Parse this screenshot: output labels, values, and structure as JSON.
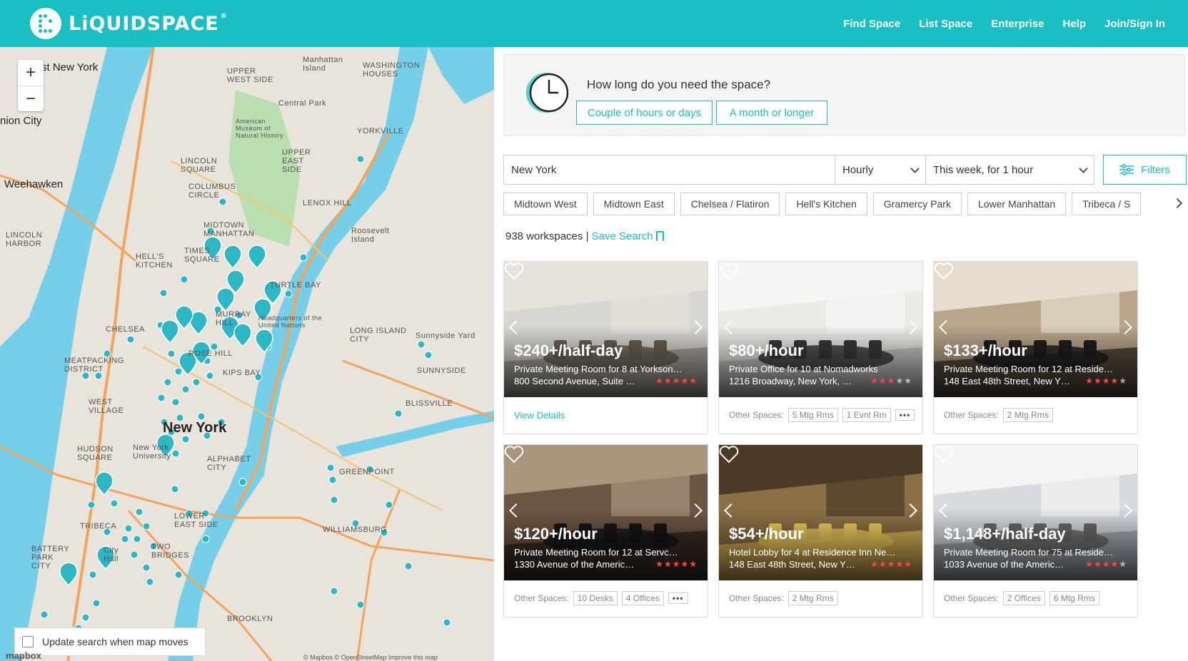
{
  "header": {
    "brand": "LiQUIDSPACE",
    "nav": [
      "Find Space",
      "List Space",
      "Enterprise",
      "Help",
      "Join/Sign In"
    ]
  },
  "map": {
    "labels": [
      "st New York",
      "nion City",
      "Weehawken",
      "UPPER WEST SIDE",
      "Manhattan Island",
      "WASHINGTON HOUSES",
      "Central Park",
      "American Museum of Natural History",
      "YORKVILLE",
      "UPPER EAST SIDE",
      "LINCOLN SQUARE",
      "COLUMBUS CIRCLE",
      "LENOX HILL",
      "LINCOLN HARBOR",
      "HELL'S KITCHEN",
      "MIDTOWN MANHATTAN",
      "TIMES SQUARE",
      "TURTLE BAY",
      "Roosevelt Island",
      "MURRAY HILL",
      "Headquarters of the United Nations",
      "CHELSEA",
      "LONG ISLAND CITY",
      "Sunnyside Yard",
      "ROSE HILL",
      "MEATPACKING DISTRICT",
      "KIPS BAY",
      "SUNNYSIDE",
      "WEST VILLAGE",
      "New York",
      "BLISSVILLE",
      "HUDSON SQUARE",
      "New York University",
      "ALPHABET CITY",
      "GREENPOINT",
      "TRIBECA",
      "LOWER EAST SIDE",
      "WILLIAMSBURG",
      "BATTERY PARK CITY",
      "TWO BRIDGES",
      "City Hall",
      "BROOKLYN"
    ],
    "update_label": "Update search when map moves",
    "credit": "mapbox",
    "attribution": "© Mapbox © OpenStreetMap Improve this map",
    "zoom_in": "+",
    "zoom_out": "−"
  },
  "duration": {
    "question": "How long do you need the space?",
    "option1": "Couple of hours or days",
    "option2": "A month or longer"
  },
  "search": {
    "location": "New York",
    "rate": "Hourly",
    "when": "This week, for 1 hour",
    "filters": "Filters"
  },
  "neighborhoods": [
    "Midtown West",
    "Midtown East",
    "Chelsea / Flatiron",
    "Hell's Kitchen",
    "Gramercy Park",
    "Lower Manhattan",
    "Tribeca / S"
  ],
  "results": {
    "count": "938 workspaces",
    "separator": "|",
    "save": "Save Search"
  },
  "cards": [
    {
      "price": "$240+/half-day",
      "name": "Private Meeting Room for 8 at Yorkson…",
      "address": "800 Second Avenue, Suite …",
      "stars": 5,
      "foot_type": "view",
      "view": "View Details",
      "tags": []
    },
    {
      "price": "$80+/hour",
      "name": "Private Office for 10 at Nomadworks",
      "address": "1216 Broadway, New York, …",
      "stars": 3,
      "foot_type": "tags",
      "foot_label": "Other Spaces:",
      "tags": [
        "5 Mtg Rms",
        "1 Evnt Rm"
      ],
      "more": "•••"
    },
    {
      "price": "$133+/hour",
      "name": "Private Meeting Room for 12 at Reside…",
      "address": "148 East 48th Street, New Y…",
      "stars": 4,
      "foot_type": "tags",
      "foot_label": "Other Spaces:",
      "tags": [
        "2 Mtg Rms"
      ]
    },
    {
      "price": "$120+/hour",
      "name": "Private Meeting Room for 12 at Servc…",
      "address": "1330 Avenue of the Americ…",
      "stars": 5,
      "foot_type": "tags",
      "foot_label": "Other Spaces:",
      "tags": [
        "10 Desks",
        "4 Offices"
      ],
      "more": "•••"
    },
    {
      "price": "$54+/hour",
      "name": "Hotel Lobby for 4 at Residence Inn Ne…",
      "address": "148 East 48th Street, New Y…",
      "stars": 5,
      "foot_type": "tags",
      "foot_label": "Other Spaces:",
      "tags": [
        "2 Mtg Rms"
      ]
    },
    {
      "price": "$1,148+/half-day",
      "name": "Private Meeting Room for 75 at Reside…",
      "address": "1033 Avenue of the Americ…",
      "stars": 4,
      "foot_type": "tags",
      "foot_label": "Other Spaces:",
      "tags": [
        "2 Offices",
        "6 Mtg Rms"
      ]
    }
  ],
  "colors": {
    "brand": "#19bfc3",
    "star": "#f44444",
    "pin": "#2bb7c3"
  }
}
